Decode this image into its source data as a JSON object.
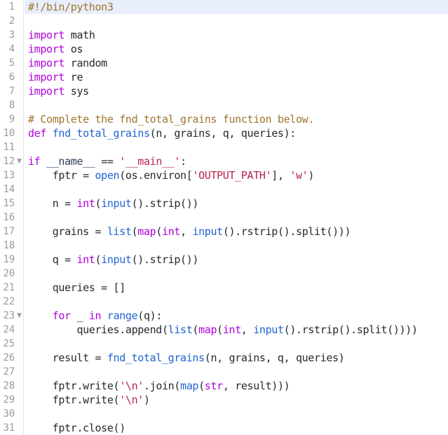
{
  "editor": {
    "language": "python",
    "active_line": 1,
    "first_line": 1,
    "last_line": 31,
    "colors": {
      "background": "#ffffff",
      "active_line": "#e8eefc",
      "gutter_text": "#9a9a9a",
      "gutter_border": "#e4e4e4",
      "comment": "#a0752a",
      "keyword": "#af00db",
      "function": "#1f62d0",
      "string": "#b5254b",
      "identifier": "#24292e"
    },
    "fold_marker": "▼",
    "fold_lines": [
      12,
      23
    ],
    "lines": [
      {
        "n": 1,
        "fold": false,
        "tokens": [
          {
            "t": "#!/bin/python3",
            "c": "t-com"
          }
        ]
      },
      {
        "n": 2,
        "fold": false,
        "tokens": []
      },
      {
        "n": 3,
        "fold": false,
        "tokens": [
          {
            "t": "import",
            "c": "t-kw"
          },
          {
            "t": " math",
            "c": "t-id"
          }
        ]
      },
      {
        "n": 4,
        "fold": false,
        "tokens": [
          {
            "t": "import",
            "c": "t-kw"
          },
          {
            "t": " os",
            "c": "t-id"
          }
        ]
      },
      {
        "n": 5,
        "fold": false,
        "tokens": [
          {
            "t": "import",
            "c": "t-kw"
          },
          {
            "t": " random",
            "c": "t-id"
          }
        ]
      },
      {
        "n": 6,
        "fold": false,
        "tokens": [
          {
            "t": "import",
            "c": "t-kw"
          },
          {
            "t": " re",
            "c": "t-id"
          }
        ]
      },
      {
        "n": 7,
        "fold": false,
        "tokens": [
          {
            "t": "import",
            "c": "t-kw"
          },
          {
            "t": " sys",
            "c": "t-id"
          }
        ]
      },
      {
        "n": 8,
        "fold": false,
        "tokens": []
      },
      {
        "n": 9,
        "fold": false,
        "tokens": [
          {
            "t": "# Complete the fnd_total_grains function below.",
            "c": "t-com"
          }
        ]
      },
      {
        "n": 10,
        "fold": false,
        "tokens": [
          {
            "t": "def",
            "c": "t-kw"
          },
          {
            "t": " ",
            "c": "t-id"
          },
          {
            "t": "fnd_total_grains",
            "c": "t-fn"
          },
          {
            "t": "(n, grains, q, queries):",
            "c": "t-id"
          }
        ]
      },
      {
        "n": 11,
        "fold": false,
        "tokens": []
      },
      {
        "n": 12,
        "fold": true,
        "tokens": [
          {
            "t": "if",
            "c": "t-kw"
          },
          {
            "t": " ",
            "c": "t-id"
          },
          {
            "t": "__name__",
            "c": "t-var"
          },
          {
            "t": " == ",
            "c": "t-op"
          },
          {
            "t": "'__main__'",
            "c": "t-str"
          },
          {
            "t": ":",
            "c": "t-id"
          }
        ]
      },
      {
        "n": 13,
        "fold": false,
        "tokens": [
          {
            "t": "    fptr = ",
            "c": "t-id"
          },
          {
            "t": "open",
            "c": "t-fn"
          },
          {
            "t": "(os.environ[",
            "c": "t-id"
          },
          {
            "t": "'OUTPUT_PATH'",
            "c": "t-str"
          },
          {
            "t": "], ",
            "c": "t-id"
          },
          {
            "t": "'w'",
            "c": "t-str"
          },
          {
            "t": ")",
            "c": "t-id"
          }
        ]
      },
      {
        "n": 14,
        "fold": false,
        "tokens": []
      },
      {
        "n": 15,
        "fold": false,
        "tokens": [
          {
            "t": "    n = ",
            "c": "t-id"
          },
          {
            "t": "int",
            "c": "t-kw"
          },
          {
            "t": "(",
            "c": "t-id"
          },
          {
            "t": "input",
            "c": "t-fn"
          },
          {
            "t": "().strip())",
            "c": "t-id"
          }
        ]
      },
      {
        "n": 16,
        "fold": false,
        "tokens": []
      },
      {
        "n": 17,
        "fold": false,
        "tokens": [
          {
            "t": "    grains = ",
            "c": "t-id"
          },
          {
            "t": "list",
            "c": "t-fn"
          },
          {
            "t": "(",
            "c": "t-id"
          },
          {
            "t": "map",
            "c": "t-kw"
          },
          {
            "t": "(",
            "c": "t-id"
          },
          {
            "t": "int",
            "c": "t-kw"
          },
          {
            "t": ", ",
            "c": "t-id"
          },
          {
            "t": "input",
            "c": "t-fn"
          },
          {
            "t": "().rstrip().split()))",
            "c": "t-id"
          }
        ]
      },
      {
        "n": 18,
        "fold": false,
        "tokens": []
      },
      {
        "n": 19,
        "fold": false,
        "tokens": [
          {
            "t": "    q = ",
            "c": "t-id"
          },
          {
            "t": "int",
            "c": "t-kw"
          },
          {
            "t": "(",
            "c": "t-id"
          },
          {
            "t": "input",
            "c": "t-fn"
          },
          {
            "t": "().strip())",
            "c": "t-id"
          }
        ]
      },
      {
        "n": 20,
        "fold": false,
        "tokens": []
      },
      {
        "n": 21,
        "fold": false,
        "tokens": [
          {
            "t": "    queries = []",
            "c": "t-id"
          }
        ]
      },
      {
        "n": 22,
        "fold": false,
        "tokens": []
      },
      {
        "n": 23,
        "fold": true,
        "tokens": [
          {
            "t": "    ",
            "c": "t-id"
          },
          {
            "t": "for",
            "c": "t-kw"
          },
          {
            "t": " _ ",
            "c": "t-id"
          },
          {
            "t": "in",
            "c": "t-kw"
          },
          {
            "t": " ",
            "c": "t-id"
          },
          {
            "t": "range",
            "c": "t-fn"
          },
          {
            "t": "(q):",
            "c": "t-id"
          }
        ]
      },
      {
        "n": 24,
        "fold": false,
        "tokens": [
          {
            "t": "        queries.append(",
            "c": "t-id"
          },
          {
            "t": "list",
            "c": "t-fn"
          },
          {
            "t": "(",
            "c": "t-id"
          },
          {
            "t": "map",
            "c": "t-kw"
          },
          {
            "t": "(",
            "c": "t-id"
          },
          {
            "t": "int",
            "c": "t-kw"
          },
          {
            "t": ", ",
            "c": "t-id"
          },
          {
            "t": "input",
            "c": "t-fn"
          },
          {
            "t": "().rstrip().split())))",
            "c": "t-id"
          }
        ]
      },
      {
        "n": 25,
        "fold": false,
        "tokens": []
      },
      {
        "n": 26,
        "fold": false,
        "tokens": [
          {
            "t": "    result = ",
            "c": "t-id"
          },
          {
            "t": "fnd_total_grains",
            "c": "t-fn"
          },
          {
            "t": "(n, grains, q, queries)",
            "c": "t-id"
          }
        ]
      },
      {
        "n": 27,
        "fold": false,
        "tokens": []
      },
      {
        "n": 28,
        "fold": false,
        "tokens": [
          {
            "t": "    fptr.write(",
            "c": "t-id"
          },
          {
            "t": "'\\n'",
            "c": "t-str"
          },
          {
            "t": ".join(",
            "c": "t-id"
          },
          {
            "t": "map",
            "c": "t-fn"
          },
          {
            "t": "(",
            "c": "t-id"
          },
          {
            "t": "str",
            "c": "t-kw"
          },
          {
            "t": ", result)))",
            "c": "t-id"
          }
        ]
      },
      {
        "n": 29,
        "fold": false,
        "tokens": [
          {
            "t": "    fptr.write(",
            "c": "t-id"
          },
          {
            "t": "'\\n'",
            "c": "t-str"
          },
          {
            "t": ")",
            "c": "t-id"
          }
        ]
      },
      {
        "n": 30,
        "fold": false,
        "tokens": []
      },
      {
        "n": 31,
        "fold": false,
        "tokens": [
          {
            "t": "    fptr.close()",
            "c": "t-id"
          }
        ]
      }
    ]
  }
}
